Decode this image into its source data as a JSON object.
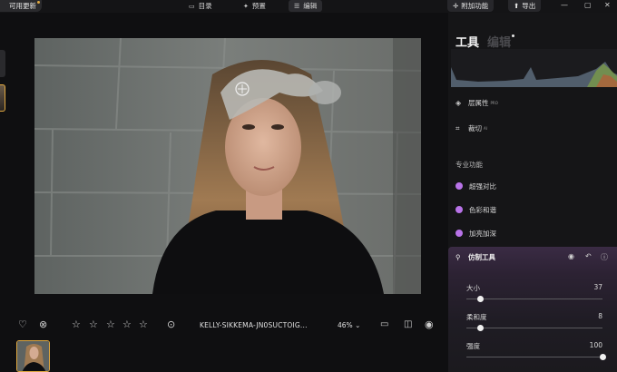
{
  "topbar": {
    "update_label": "可用更新",
    "tabs": [
      {
        "label": "目录",
        "icon": "folder-icon"
      },
      {
        "label": "预置",
        "icon": "sparkle-icon"
      },
      {
        "label": "编辑",
        "icon": "sliders-icon",
        "active": true
      }
    ],
    "addons_label": "附加功能",
    "export_label": "导出",
    "window_controls": [
      "minimize-icon",
      "maximize-icon",
      "close-icon"
    ]
  },
  "canvas": {
    "cursor_icon": "clone-stamp-cursor-icon"
  },
  "bottombar": {
    "filename": "KELLY-SIKKEMA-JN0SUCTOIG...",
    "zoom": "46%",
    "rating_stars": 5,
    "icons": [
      "heart-icon",
      "reject-icon",
      "star-icon",
      "more-icon",
      "compare-icon",
      "split-view-icon",
      "eye-icon"
    ]
  },
  "panel": {
    "tabs": [
      "工具",
      "编辑"
    ],
    "active_tab": "工具",
    "rows": [
      {
        "label": "层属性",
        "badge": "PRO",
        "icon": "layers-icon"
      },
      {
        "label": "裁切",
        "badge": "AI",
        "icon": "crop-icon"
      }
    ],
    "section_title": "专业功能",
    "pro_tools": [
      {
        "label": "超强对比"
      },
      {
        "label": "色彩和谐"
      },
      {
        "label": "加亮加深"
      }
    ],
    "clone": {
      "title": "仿制工具",
      "sliders": [
        {
          "label": "大小",
          "value": "37",
          "fraction": 0.1
        },
        {
          "label": "柔和度",
          "value": "8",
          "fraction": 0.1
        },
        {
          "label": "强度",
          "value": "100",
          "fraction": 1.0
        }
      ]
    }
  },
  "colors": {
    "accent": "#e0a840",
    "pro_purple": "#b873e8",
    "panel_bg": "#151517"
  }
}
